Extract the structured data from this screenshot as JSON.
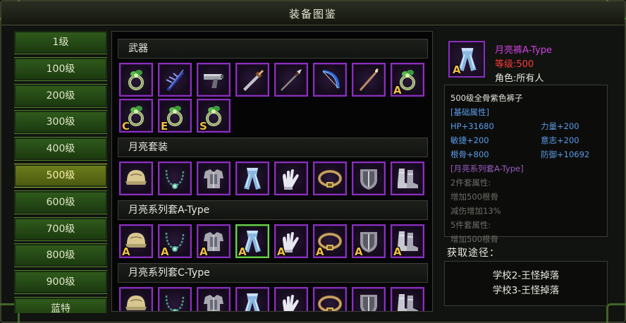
{
  "window": {
    "title": "装备图鉴"
  },
  "levels": [
    "1级",
    "100级",
    "200级",
    "300级",
    "400级",
    "500级",
    "600级",
    "700级",
    "800级",
    "900级",
    "蓝特"
  ],
  "active_level_index": 5,
  "sections": [
    {
      "title": "武器",
      "items": [
        {
          "icon": "ring-icon",
          "badge": ""
        },
        {
          "icon": "claw-weapon-icon",
          "badge": ""
        },
        {
          "icon": "pistol-icon",
          "badge": ""
        },
        {
          "icon": "dagger-icon",
          "badge": ""
        },
        {
          "icon": "spear-icon",
          "badge": ""
        },
        {
          "icon": "bow-icon",
          "badge": ""
        },
        {
          "icon": "staff-icon",
          "badge": ""
        },
        {
          "icon": "ring-icon",
          "badge": "A"
        },
        {
          "icon": "ring-icon",
          "badge": "C"
        },
        {
          "icon": "ring-icon",
          "badge": "E"
        },
        {
          "icon": "ring-icon",
          "badge": "S"
        }
      ]
    },
    {
      "title": "月亮套装",
      "items": [
        {
          "icon": "helmet-icon",
          "badge": ""
        },
        {
          "icon": "necklace-icon",
          "badge": ""
        },
        {
          "icon": "armor-icon",
          "badge": ""
        },
        {
          "icon": "pants-icon",
          "badge": ""
        },
        {
          "icon": "gloves-icon",
          "badge": ""
        },
        {
          "icon": "belt-icon",
          "badge": ""
        },
        {
          "icon": "shield-icon",
          "badge": ""
        },
        {
          "icon": "boots-icon",
          "badge": ""
        }
      ]
    },
    {
      "title": "月亮系列套A-Type",
      "items": [
        {
          "icon": "helmet-icon",
          "badge": "A"
        },
        {
          "icon": "necklace-icon",
          "badge": "A"
        },
        {
          "icon": "armor-icon",
          "badge": "A"
        },
        {
          "icon": "pants-icon",
          "badge": "A",
          "selected": true
        },
        {
          "icon": "gloves-icon",
          "badge": "A"
        },
        {
          "icon": "belt-icon",
          "badge": "A"
        },
        {
          "icon": "shield-icon",
          "badge": "A"
        },
        {
          "icon": "boots-icon",
          "badge": "A"
        }
      ]
    },
    {
      "title": "月亮系列套C-Type",
      "items": [
        {
          "icon": "helmet-icon",
          "badge": ""
        },
        {
          "icon": "necklace-icon",
          "badge": ""
        },
        {
          "icon": "armor-icon",
          "badge": ""
        },
        {
          "icon": "pants-icon",
          "badge": ""
        },
        {
          "icon": "gloves-icon",
          "badge": ""
        },
        {
          "icon": "belt-icon",
          "badge": ""
        },
        {
          "icon": "shield-icon",
          "badge": ""
        },
        {
          "icon": "boots-icon",
          "badge": ""
        }
      ]
    }
  ],
  "detail": {
    "name": "月亮裤A-Type",
    "level": "等级:500",
    "role": "角色:所有人",
    "icon": "pants-icon",
    "icon_badge": "A",
    "description": "500级全骨紫色裤子",
    "base_attr_label": "[基础属性]",
    "attrs": [
      [
        "HP+31680",
        "力量+200"
      ],
      [
        "敏捷+200",
        "意志+200"
      ],
      [
        "根骨+800",
        "防御+10692"
      ]
    ],
    "set_name": "[月亮系列套A-Type]",
    "set_bonus": [
      "2件套属性:",
      "增加500根骨",
      "减伤增加13%",
      "5件套属性:",
      "增加500根骨"
    ],
    "source_title": "获取途径：",
    "sources": [
      "学校2-王怪掉落",
      "学校3-王怪掉落"
    ]
  },
  "colors": {
    "slot_border": "#8a2fbf",
    "selected_border": "#6ad04a",
    "item_name": "#d040e0",
    "item_level": "#ff3a3a",
    "attr_blue": "#5a9ae8",
    "set_purple": "#9a5ac0"
  }
}
